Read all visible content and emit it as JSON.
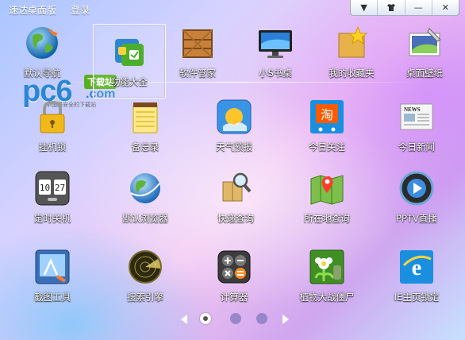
{
  "app": {
    "title": "速达桌面版",
    "login": "登录"
  },
  "window_controls": [
    {
      "name": "dropdown",
      "glyph": "▼"
    },
    {
      "name": "skin",
      "glyph": "👕"
    },
    {
      "name": "minimize",
      "glyph": "—"
    },
    {
      "name": "close",
      "glyph": "✕"
    }
  ],
  "watermark": {
    "pc6": "pc6",
    "com": ".com",
    "badge": "下载站",
    "sub": "中国最安全的下载站"
  },
  "apps": [
    {
      "label": "默认导航",
      "icon": "globe-nav-icon"
    },
    {
      "label": "功能大全",
      "icon": "function-box-icon",
      "selected": true
    },
    {
      "label": "软件管家",
      "icon": "wooden-crate-icon"
    },
    {
      "label": "小S书桌",
      "icon": "monitor-icon"
    },
    {
      "label": "我的收藏夹",
      "icon": "favorites-folder-icon"
    },
    {
      "label": "桌面壁纸",
      "icon": "wallpaper-icon"
    },
    {
      "label": "挂机锁",
      "icon": "padlock-icon"
    },
    {
      "label": "备忘录",
      "icon": "notepad-icon"
    },
    {
      "label": "天气预报",
      "icon": "weather-sun-icon"
    },
    {
      "label": "今日关注",
      "icon": "taobao-cart-icon"
    },
    {
      "label": "今日新闻",
      "icon": "newspaper-icon"
    },
    {
      "label": "定时关机",
      "icon": "clock-icon"
    },
    {
      "label": "默认浏览器",
      "icon": "browser-globe-icon"
    },
    {
      "label": "快递查询",
      "icon": "parcel-search-icon"
    },
    {
      "label": "所在地查询",
      "icon": "map-pin-icon"
    },
    {
      "label": "PPTV直播",
      "icon": "pptv-icon"
    },
    {
      "label": "截图工具",
      "icon": "screenshot-tool-icon"
    },
    {
      "label": "搜索引擎",
      "icon": "radar-search-icon"
    },
    {
      "label": "计算器",
      "icon": "calculator-icon"
    },
    {
      "label": "植物大战僵尸",
      "icon": "plants-vs-zombies-icon"
    },
    {
      "label": "IE主页锁定",
      "icon": "ie-lock-icon"
    }
  ],
  "pager": {
    "pages": 3,
    "current": 1
  }
}
